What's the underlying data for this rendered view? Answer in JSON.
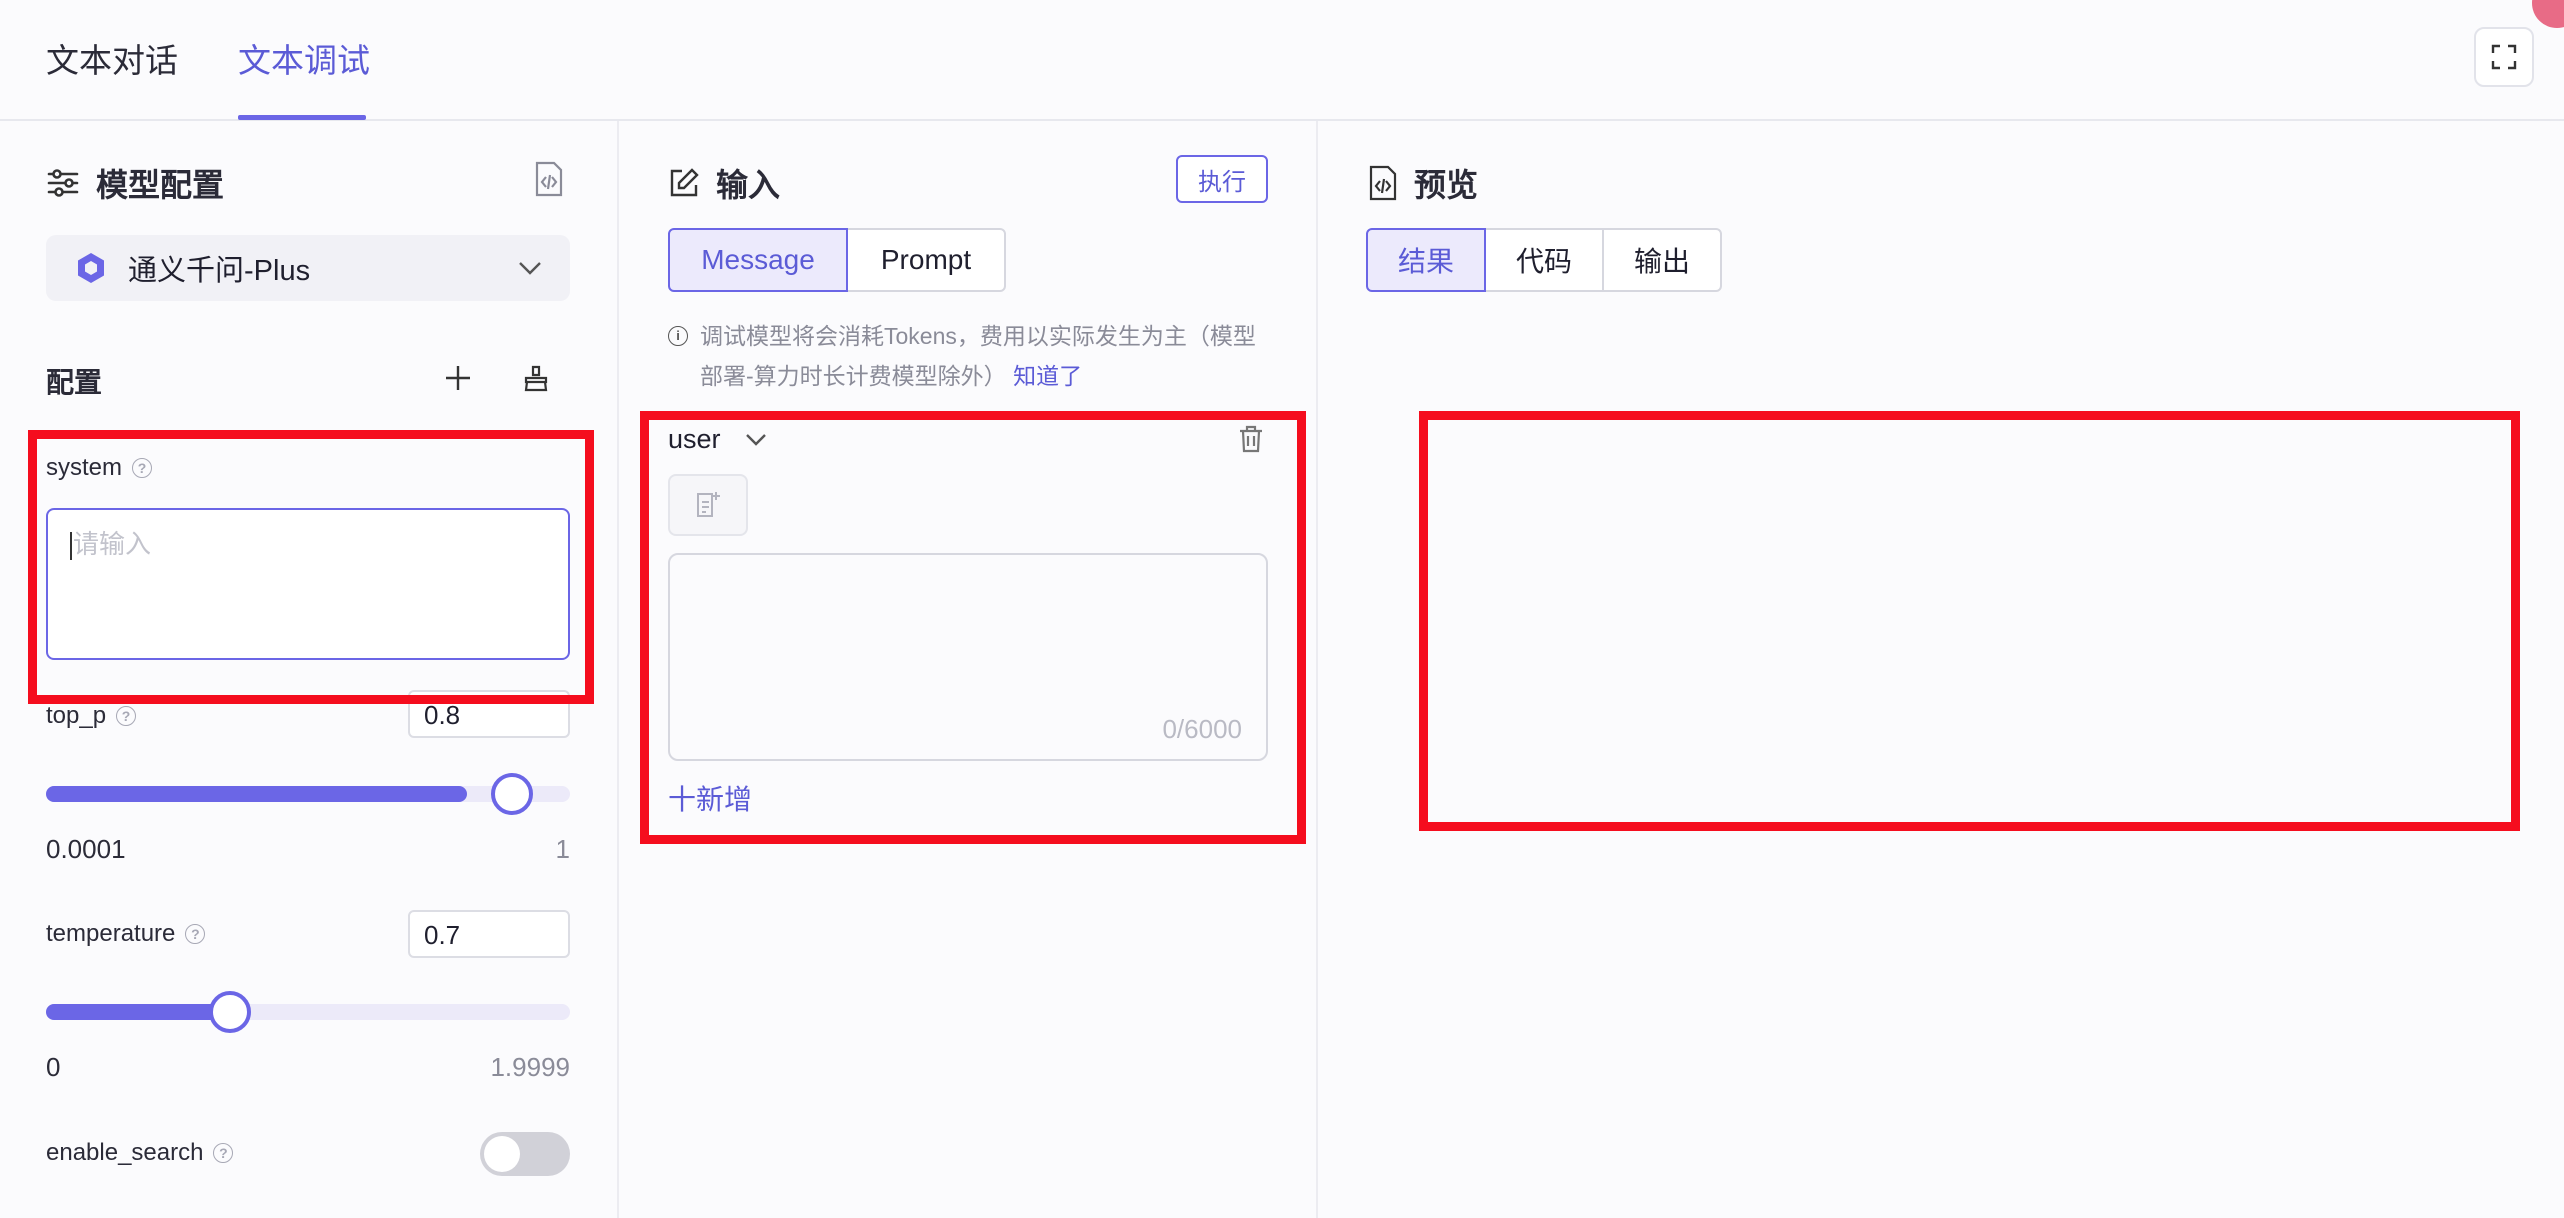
{
  "tabs": [
    {
      "label": "文本对话",
      "active": false
    },
    {
      "label": "文本调试",
      "active": true
    }
  ],
  "colors": {
    "accent": "#6b66e6",
    "highlight": "#f50d1e"
  },
  "model_config": {
    "title": "模型配置",
    "model_name": "通义千问-Plus",
    "config_label": "配置",
    "system": {
      "label": "system",
      "placeholder": "请输入",
      "help": "?"
    },
    "top_p": {
      "label": "top_p",
      "value": "0.8",
      "min": "0.0001",
      "max": "1",
      "help": "?"
    },
    "temperature": {
      "label": "temperature",
      "value": "0.7",
      "min": "0",
      "max": "1.9999",
      "help": "?"
    },
    "enable_search": {
      "label": "enable_search",
      "enabled": false,
      "help": "?"
    }
  },
  "input_panel": {
    "title": "输入",
    "execute_label": "执行",
    "modes": [
      "Message",
      "Prompt"
    ],
    "active_mode": "Message",
    "notice_icon": "i",
    "notice_text": "调试模型将会消耗Tokens，费用以实际发生为主（模型部署-算力时长计费模型除外）",
    "notice_link": "知道了",
    "role": "user",
    "char_counter": "0/6000",
    "add_label": "十新增"
  },
  "preview_panel": {
    "title": "预览",
    "tabs": [
      "结果",
      "代码",
      "输出"
    ],
    "active_tab": "结果"
  }
}
